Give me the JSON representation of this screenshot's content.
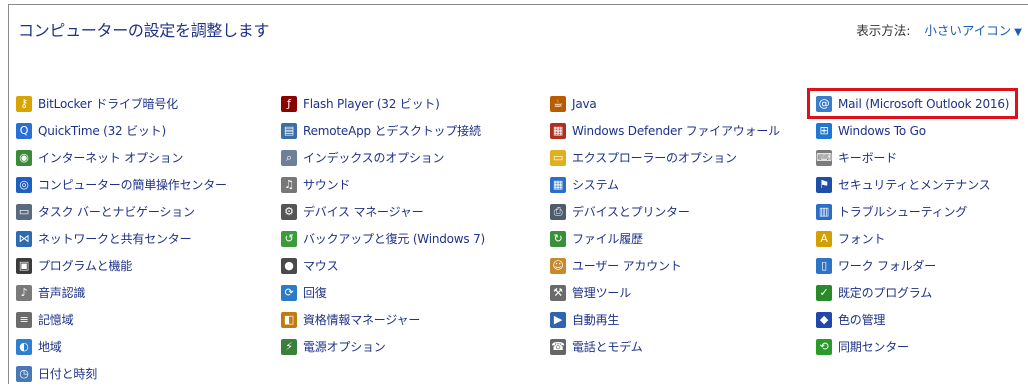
{
  "header": {
    "title": "コンピューターの設定を調整します",
    "view_by_label": "表示方法:",
    "view_by_value": "小さいアイコン"
  },
  "columns": [
    [
      {
        "label": "BitLocker ドライブ暗号化",
        "icon": "bitlocker-key-icon"
      },
      {
        "label": "QuickTime (32 ビット)",
        "icon": "quicktime-icon"
      },
      {
        "label": "インターネット オプション",
        "icon": "internet-options-icon"
      },
      {
        "label": "コンピューターの簡単操作センター",
        "icon": "ease-of-access-icon"
      },
      {
        "label": "タスク バーとナビゲーション",
        "icon": "taskbar-icon"
      },
      {
        "label": "ネットワークと共有センター",
        "icon": "network-icon"
      },
      {
        "label": "プログラムと機能",
        "icon": "programs-icon"
      },
      {
        "label": "音声認識",
        "icon": "microphone-icon"
      },
      {
        "label": "記憶域",
        "icon": "storage-icon"
      },
      {
        "label": "地域",
        "icon": "region-globe-icon"
      },
      {
        "label": "日付と時刻",
        "icon": "clock-icon"
      }
    ],
    [
      {
        "label": "Flash Player (32 ビット)",
        "icon": "flash-icon"
      },
      {
        "label": "RemoteApp とデスクトップ接続",
        "icon": "remoteapp-icon"
      },
      {
        "label": "インデックスのオプション",
        "icon": "indexing-icon"
      },
      {
        "label": "サウンド",
        "icon": "speaker-icon"
      },
      {
        "label": "デバイス マネージャー",
        "icon": "device-manager-icon"
      },
      {
        "label": "バックアップと復元 (Windows 7)",
        "icon": "backup-icon"
      },
      {
        "label": "マウス",
        "icon": "mouse-icon"
      },
      {
        "label": "回復",
        "icon": "recovery-icon"
      },
      {
        "label": "資格情報マネージャー",
        "icon": "credential-icon"
      },
      {
        "label": "電源オプション",
        "icon": "power-icon"
      }
    ],
    [
      {
        "label": "Java",
        "icon": "java-icon"
      },
      {
        "label": "Windows Defender ファイアウォール",
        "icon": "firewall-icon"
      },
      {
        "label": "エクスプローラーのオプション",
        "icon": "folder-options-icon"
      },
      {
        "label": "システム",
        "icon": "system-icon"
      },
      {
        "label": "デバイスとプリンター",
        "icon": "printer-icon"
      },
      {
        "label": "ファイル履歴",
        "icon": "file-history-icon"
      },
      {
        "label": "ユーザー アカウント",
        "icon": "users-icon"
      },
      {
        "label": "管理ツール",
        "icon": "admin-tools-icon"
      },
      {
        "label": "自動再生",
        "icon": "autoplay-icon"
      },
      {
        "label": "電話とモデム",
        "icon": "phone-modem-icon"
      }
    ],
    [
      {
        "label": "Mail (Microsoft Outlook 2016)",
        "icon": "mail-icon"
      },
      {
        "label": "Windows To Go",
        "icon": "windows-to-go-icon"
      },
      {
        "label": "キーボード",
        "icon": "keyboard-icon"
      },
      {
        "label": "セキュリティとメンテナンス",
        "icon": "flag-icon"
      },
      {
        "label": "トラブルシューティング",
        "icon": "troubleshoot-icon"
      },
      {
        "label": "フォント",
        "icon": "font-icon"
      },
      {
        "label": "ワーク フォルダー",
        "icon": "work-folders-icon"
      },
      {
        "label": "既定のプログラム",
        "icon": "default-programs-icon"
      },
      {
        "label": "色の管理",
        "icon": "color-management-icon"
      },
      {
        "label": "同期センター",
        "icon": "sync-center-icon"
      }
    ]
  ],
  "highlight_color": "#e0101a"
}
